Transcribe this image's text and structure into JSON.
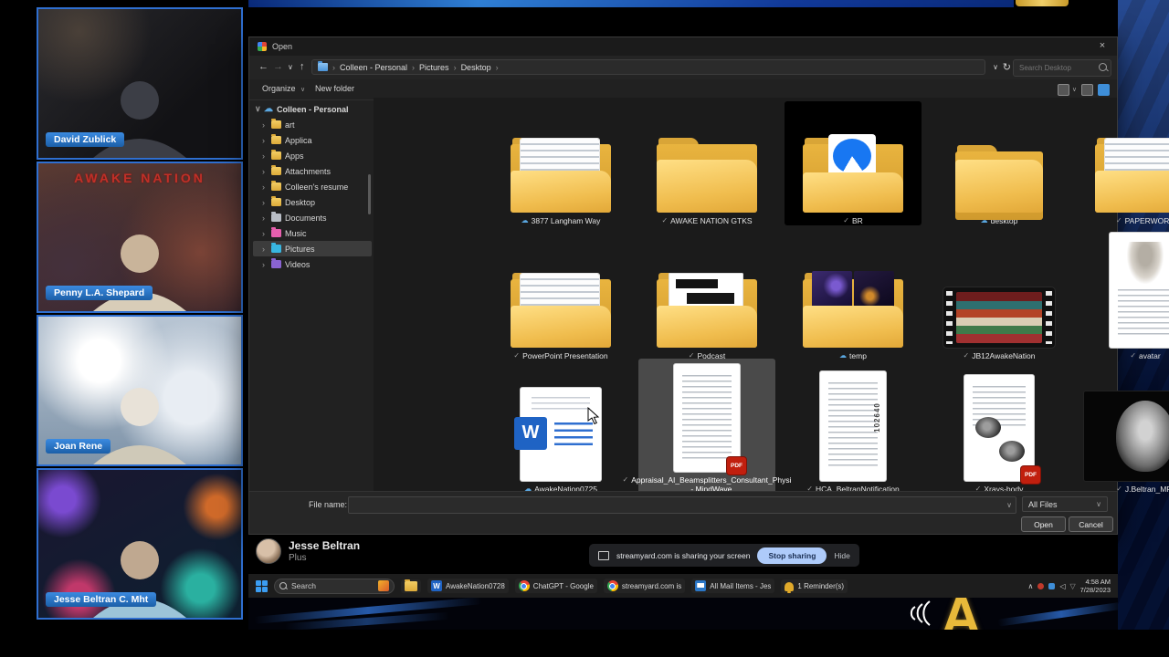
{
  "icons": {
    "back": "←",
    "forward": "→",
    "up": "↑",
    "refresh": "↻",
    "caret": "∨",
    "chevron": "›",
    "expanded": "∨",
    "close": "×",
    "cloud": "☁",
    "check": "✓",
    "word": "W",
    "pdf": "PDF",
    "tray_caret": "∧"
  },
  "participants": [
    {
      "name": "David Zublick"
    },
    {
      "name": "Penny L.A. Shepard",
      "backdrop": "AWAKE NATION"
    },
    {
      "name": "Joan Rene"
    },
    {
      "name": "Jesse Beltran C. Mht"
    }
  ],
  "dialog": {
    "title": "Open",
    "breadcrumb": [
      "Colleen - Personal",
      "Pictures",
      "Desktop"
    ],
    "search_placeholder": "Search Desktop",
    "toolbar": {
      "organize": "Organize",
      "new_folder": "New folder"
    },
    "tree": {
      "root": "Colleen - Personal",
      "items": [
        {
          "label": "art"
        },
        {
          "label": "Applica"
        },
        {
          "label": "Apps"
        },
        {
          "label": "Attachments"
        },
        {
          "label": "Colleen's resume"
        },
        {
          "label": "Desktop"
        },
        {
          "label": "Documents"
        },
        {
          "label": "Music"
        },
        {
          "label": "Pictures"
        },
        {
          "label": "Videos"
        }
      ]
    },
    "files": [
      {
        "name": "3877 Langham Way",
        "status": "cloud"
      },
      {
        "name": "AWAKE NATION GTKS",
        "status": "pinned"
      },
      {
        "name": "BR",
        "status": "pinned"
      },
      {
        "name": "desktop",
        "status": "cloud"
      },
      {
        "name": "PAPERWORK",
        "status": "pinned"
      },
      {
        "name": "PowerPoint Presentation",
        "status": "pinned"
      },
      {
        "name": "Podcast",
        "status": "pinned"
      },
      {
        "name": "temp",
        "status": "cloud"
      },
      {
        "name": "JB12AwakeNation",
        "status": "pinned"
      },
      {
        "name": "avatar",
        "status": "pinned"
      },
      {
        "name": "AwakeNation0725",
        "status": "cloud"
      },
      {
        "name": "Appraisal_AI_Beamsplitters_Consultant_Physi - MindWave",
        "status": "pinned",
        "selected": true
      },
      {
        "name": "HCA_BeltranNotification",
        "status": "pinned",
        "annotation": "102640"
      },
      {
        "name": "Xrays-body",
        "status": "pinned"
      },
      {
        "name": "J.Beltran_MRI",
        "status": "pinned"
      }
    ],
    "footer": {
      "file_name_label": "File name:",
      "file_name_value": "",
      "file_type": "All Files",
      "open_label": "Open",
      "cancel_label": "Cancel"
    }
  },
  "streamyard": {
    "presenter": "Jesse Beltran",
    "plan": "Plus",
    "sharing_text": "streamyard.com is sharing your screen",
    "stop_sharing_label": "Stop sharing",
    "hide_label": "Hide"
  },
  "taskbar": {
    "search_label": "Search",
    "apps": [
      {
        "label": "AwakeNation0728"
      },
      {
        "label": "ChatGPT - Google"
      },
      {
        "label": "streamyard.com is"
      },
      {
        "label": "All Mail Items - Jes"
      },
      {
        "label": "1 Reminder(s)"
      }
    ],
    "clock": {
      "time": "4:58 AM",
      "date": "7/28/2023"
    }
  }
}
